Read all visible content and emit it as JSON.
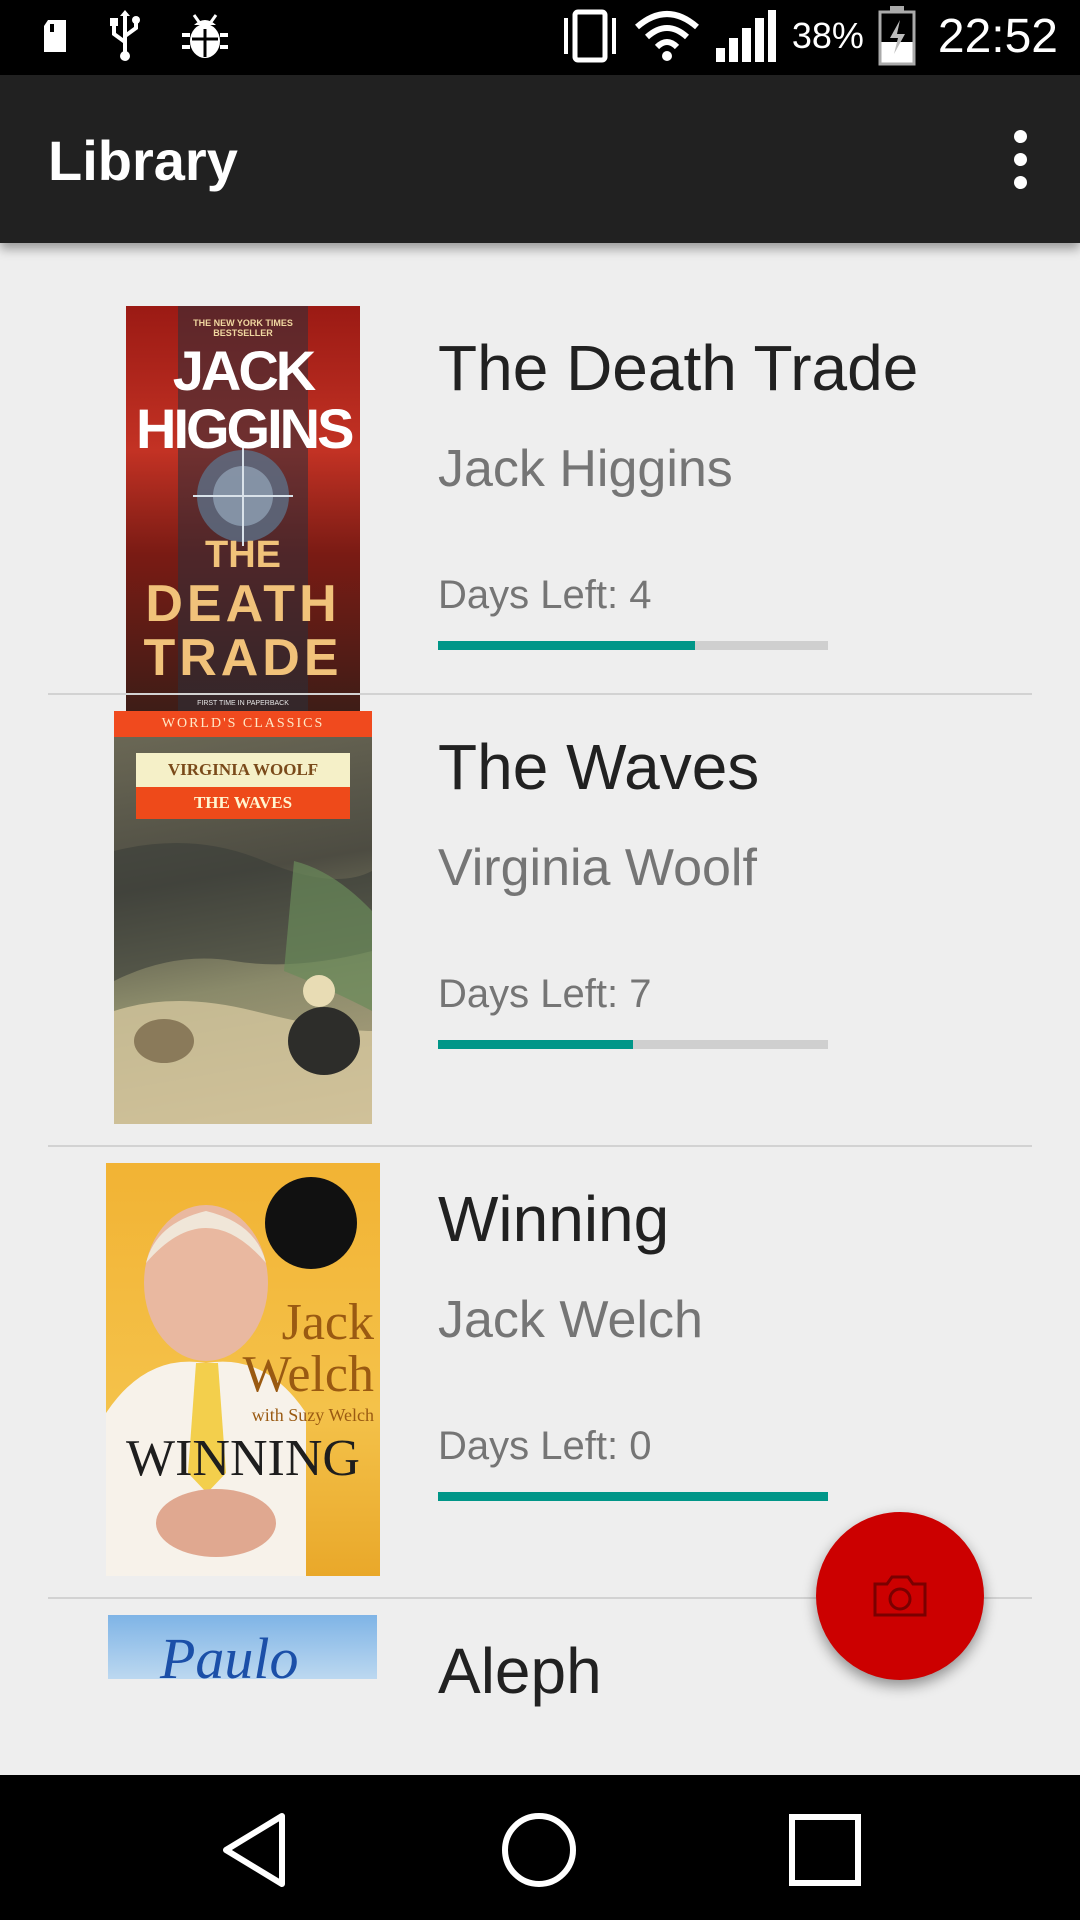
{
  "status_bar": {
    "battery_percent": "38%",
    "time": "22:52",
    "icons": [
      "sd-card-icon",
      "usb-icon",
      "debug-bug-icon",
      "vibrate-icon",
      "wifi-icon",
      "signal-icon",
      "battery-charging-icon"
    ]
  },
  "app_bar": {
    "title": "Library",
    "overflow_icon": "more-vert-icon"
  },
  "books": [
    {
      "title": "The Death Trade",
      "author": "Jack Higgins",
      "days_left": "Days Left: 4",
      "progress": 0.66,
      "cover": {
        "top_text": "THE NEW YORK TIMES BESTSELLER",
        "author": "JACK HIGGINS",
        "title_1": "THE",
        "title_2": "DEATH",
        "title_3": "TRADE",
        "bottom_text": "FIRST TIME IN PAPERBACK"
      }
    },
    {
      "title": "The Waves",
      "author": "Virginia Woolf",
      "days_left": "Days Left: 7",
      "progress": 0.5,
      "cover": {
        "series": "WORLD'S CLASSICS",
        "author": "VIRGINIA WOOLF",
        "title": "THE WAVES"
      }
    },
    {
      "title": "Winning",
      "author": "Jack Welch",
      "days_left": "Days Left: 0",
      "progress": 1.0,
      "cover": {
        "author_1": "Jack",
        "author_2": "Welch",
        "coauthor": "with Suzy Welch",
        "title": "WINNING"
      }
    },
    {
      "title": "Aleph",
      "author": "",
      "days_left": "",
      "progress": null,
      "cover": {
        "author": "Paulo"
      }
    }
  ],
  "fab": {
    "icon": "camera-icon"
  },
  "nav_bar": {
    "icons": [
      "back-icon",
      "home-icon",
      "recents-icon"
    ]
  },
  "colors": {
    "accent": "#009688",
    "fab": "#cc0000",
    "app_bar": "#212121",
    "background": "#eeeeee"
  }
}
